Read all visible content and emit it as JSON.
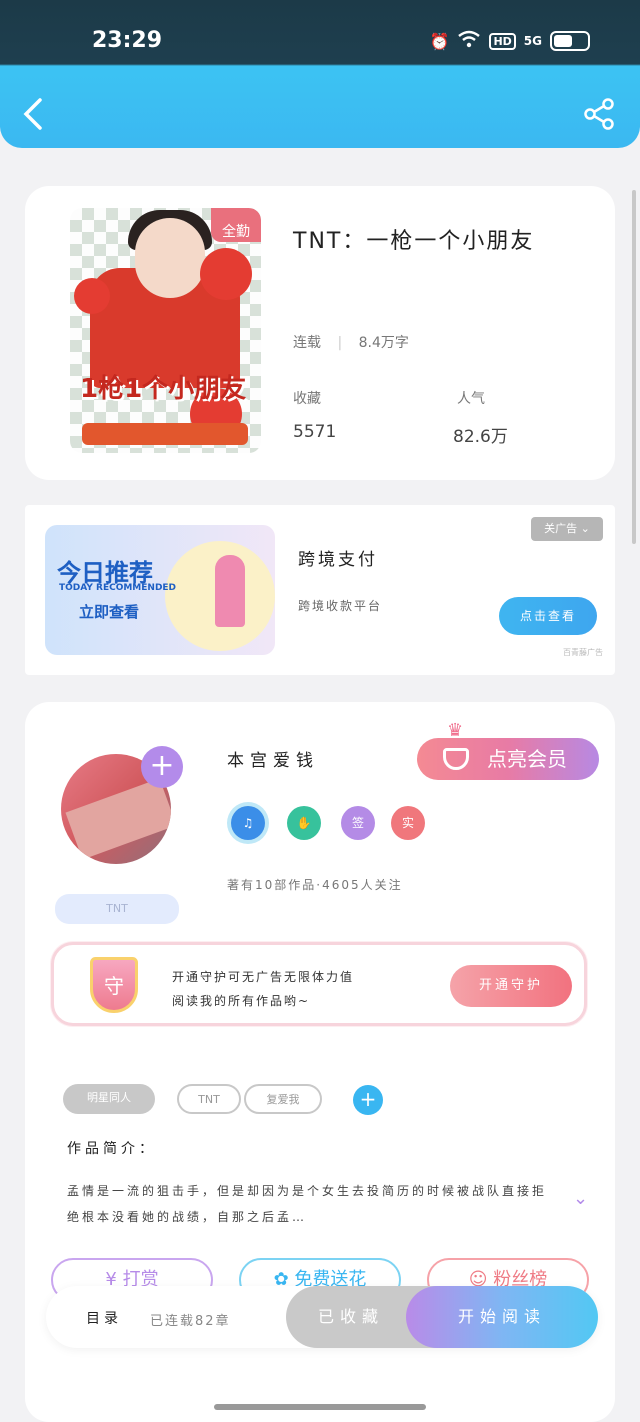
{
  "status": {
    "time": "23:29",
    "hd": "HD",
    "signal": "5G"
  },
  "header": {
    "back_icon": "chevron-left-icon",
    "share_icon": "share-icon"
  },
  "book": {
    "badge": "全勤",
    "cover_text": "1枪1个小朋友",
    "title": "TNT：一枪一个小朋友",
    "status": "连载",
    "word_count": "8.4万字",
    "collect_label": "收藏",
    "collect_value": "5571",
    "popularity_label": "人气",
    "popularity_value": "82.6万"
  },
  "ad": {
    "image_title": "今日推荐",
    "image_sub": "TODAY RECOMMENDED",
    "image_cta": "立即查看",
    "title": "跨境支付",
    "subtitle": "跨境收款平台",
    "tag": "关广告",
    "button": "点击查看",
    "footer": "百青藤广告"
  },
  "author": {
    "name": "本宫爱钱",
    "vip_button": "点亮会员",
    "stats": "著有10部作品·4605人关注",
    "fan_label": "TNT",
    "badges": [
      "music-badge",
      "handshake-badge",
      "签",
      "实"
    ]
  },
  "guard": {
    "icon_text": "守",
    "text_line1": "开通守护可无广告无限体力值",
    "text_line2": "阅读我的所有作品哟~",
    "button": "开通守护"
  },
  "tags": [
    "明星同人",
    "TNT",
    "复爱我"
  ],
  "intro": {
    "label": "作品简介：",
    "text": "孟情是一流的狙击手，但是却因为是个女生去投简历的时候被战队直接拒绝根本没看她的战绩，自那之后孟…"
  },
  "actions": {
    "tip": "打赏",
    "flower": "免费送花",
    "fans": "粉丝榜"
  },
  "bottom": {
    "toc": "目录",
    "serial": "已连载82章",
    "collected": "已收藏",
    "read": "开始阅读"
  }
}
